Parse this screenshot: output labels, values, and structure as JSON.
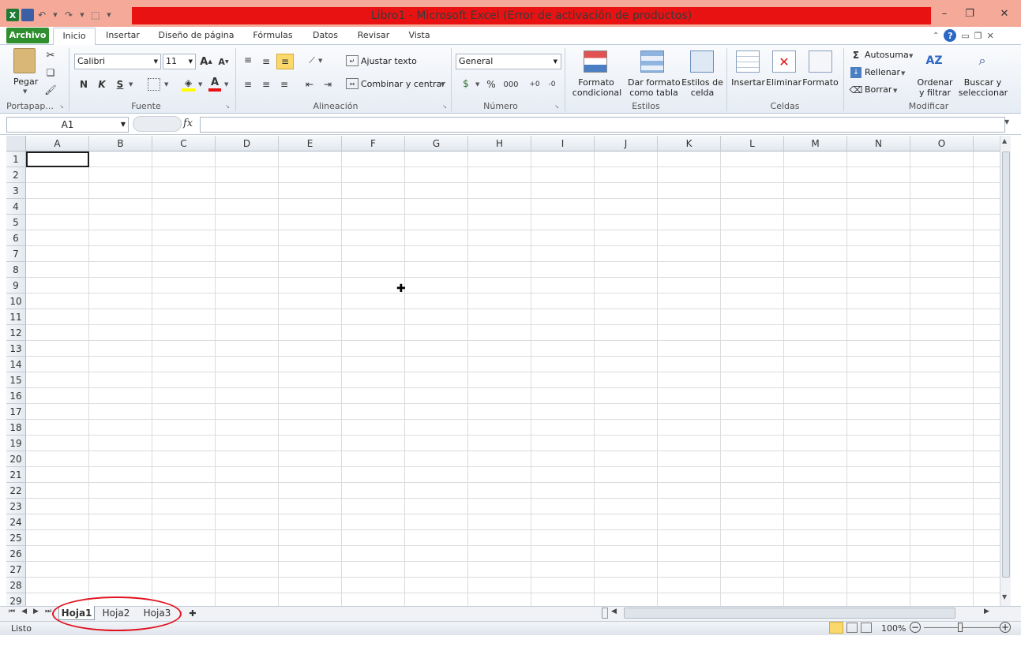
{
  "window": {
    "title": "Libro1  -  Microsoft Excel (Error de activación de productos)",
    "title_bar_color": "#e81212",
    "controls": [
      "minimize",
      "restore",
      "close"
    ]
  },
  "quick_access": [
    "excel-logo-icon",
    "save-icon",
    "undo-icon",
    "redo-icon",
    "customize-qat-icon"
  ],
  "ribbon_tabs": {
    "archivo": "Archivo",
    "inicio": "Inicio",
    "insertar": "Insertar",
    "diseno": "Diseño de página",
    "formulas": "Fórmulas",
    "datos": "Datos",
    "revisar": "Revisar",
    "vista": "Vista"
  },
  "ribbon": {
    "portapapeles": {
      "label": "Portapap...",
      "pegar": "Pegar"
    },
    "fuente": {
      "label": "Fuente",
      "font_name": "Calibri",
      "font_size": "11",
      "bold": "N",
      "italic": "K",
      "underline": "S"
    },
    "alineacion": {
      "label": "Alineación",
      "ajustar": "Ajustar texto",
      "combinar": "Combinar y centrar"
    },
    "numero": {
      "label": "Número",
      "format": "General",
      "percent": "%",
      "thousands": "000"
    },
    "estilos": {
      "label": "Estilos",
      "formato_cond_1": "Formato",
      "formato_cond_2": "condicional",
      "dar_formato_1": "Dar formato",
      "dar_formato_2": "como tabla",
      "estilos_celda_1": "Estilos de",
      "estilos_celda_2": "celda"
    },
    "celdas": {
      "label": "Celdas",
      "insertar": "Insertar",
      "eliminar": "Eliminar",
      "formato": "Formato"
    },
    "modificar": {
      "label": "Modificar",
      "autosuma": "Autosuma",
      "rellenar": "Rellenar",
      "borrar": "Borrar",
      "ordenar_1": "Ordenar",
      "ordenar_2": "y filtrar",
      "buscar_1": "Buscar y",
      "buscar_2": "seleccionar"
    }
  },
  "formula_bar": {
    "name_box": "A1",
    "fx": "fx",
    "value": ""
  },
  "grid": {
    "columns": [
      "A",
      "B",
      "C",
      "D",
      "E",
      "F",
      "G",
      "H",
      "I",
      "J",
      "K",
      "L",
      "M",
      "N",
      "O"
    ],
    "rows": [
      "1",
      "2",
      "3",
      "4",
      "5",
      "6",
      "7",
      "8",
      "9",
      "10",
      "11",
      "12",
      "13",
      "14",
      "15",
      "16",
      "17",
      "18",
      "19",
      "20",
      "21",
      "22",
      "23",
      "24",
      "25",
      "26",
      "27",
      "28",
      "29"
    ],
    "selected_cell": "A1"
  },
  "sheets": {
    "tabs": [
      "Hoja1",
      "Hoja2",
      "Hoja3"
    ],
    "active": "Hoja1"
  },
  "status": {
    "ready": "Listo",
    "zoom": "100%"
  },
  "annotation_color": "#e0131f"
}
